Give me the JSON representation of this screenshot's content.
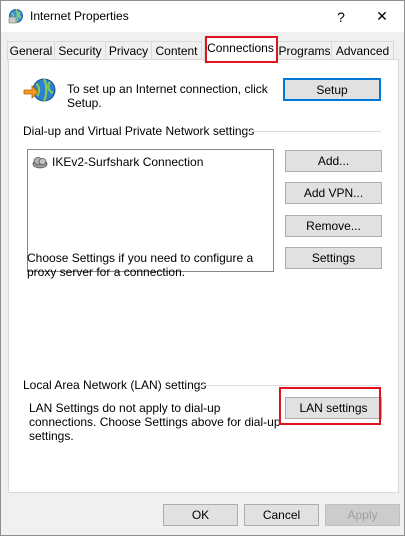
{
  "window": {
    "title": "Internet Properties",
    "help_glyph": "?",
    "close_glyph": "✕"
  },
  "tabs": [
    {
      "label": "General"
    },
    {
      "label": "Security"
    },
    {
      "label": "Privacy"
    },
    {
      "label": "Content"
    },
    {
      "label": "Connections",
      "active": true
    },
    {
      "label": "Programs"
    },
    {
      "label": "Advanced"
    }
  ],
  "setup": {
    "description": "To set up an Internet connection, click Setup.",
    "button": "Setup"
  },
  "vpn": {
    "group_label": "Dial-up and Virtual Private Network settings",
    "connections": [
      "IKEv2-Surfshark Connection"
    ],
    "add_button": "Add...",
    "add_vpn_button": "Add VPN...",
    "remove_button": "Remove...",
    "proxy_text": "Choose Settings if you need to configure a proxy server for a connection.",
    "settings_button": "Settings"
  },
  "lan": {
    "group_label": "Local Area Network (LAN) settings",
    "text": "LAN Settings do not apply to dial-up connections. Choose Settings above for dial-up settings.",
    "button": "LAN settings"
  },
  "footer": {
    "ok": "OK",
    "cancel": "Cancel",
    "apply": "Apply"
  },
  "colors": {
    "highlight": "#e1121b",
    "default_button_border": "#0078d7"
  }
}
